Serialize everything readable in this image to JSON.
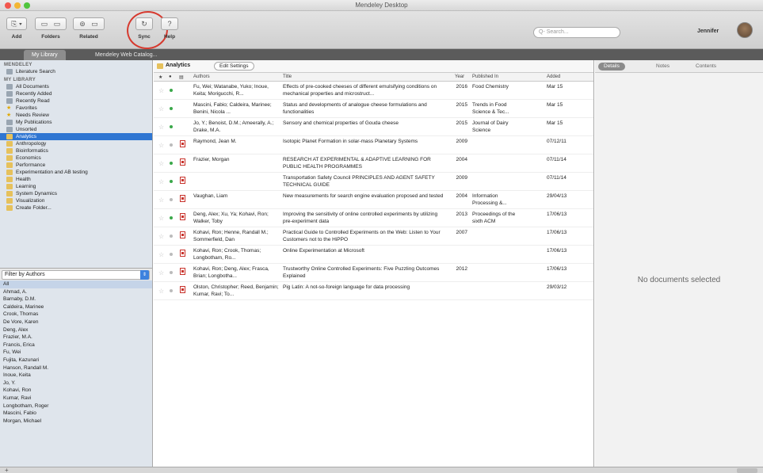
{
  "window": {
    "title": "Mendeley Desktop"
  },
  "toolbar": {
    "buttons": [
      {
        "label": "Add"
      },
      {
        "label": "Folders"
      },
      {
        "label": "Related"
      },
      {
        "label": "Sync"
      },
      {
        "label": "Help"
      }
    ],
    "search_placeholder": "Q- Search...",
    "user_name": "Jennifer"
  },
  "tabs": [
    {
      "label": "My Library",
      "active": true
    },
    {
      "label": "Mendeley Web Catalog...",
      "active": false
    }
  ],
  "sidebar": {
    "mendeley_header": "MENDELEY",
    "mendeley_items": [
      "Literature Search"
    ],
    "library_header": "MY LIBRARY",
    "library_items": [
      {
        "label": "All Documents",
        "icon": "grey"
      },
      {
        "label": "Recently Added",
        "icon": "grey"
      },
      {
        "label": "Recently Read",
        "icon": "grey"
      },
      {
        "label": "Favorites",
        "icon": "star"
      },
      {
        "label": "Needs Review",
        "icon": "star"
      },
      {
        "label": "My Publications",
        "icon": "grey"
      },
      {
        "label": "Unsorted",
        "icon": "grey"
      }
    ],
    "folders": [
      {
        "label": "Analytics",
        "selected": true,
        "sub": false
      },
      {
        "label": "Anthropology",
        "selected": false,
        "sub": false
      },
      {
        "label": "Bioinformatics",
        "selected": false,
        "sub": false
      },
      {
        "label": "Economics",
        "selected": false,
        "sub": false
      },
      {
        "label": "Performance",
        "selected": false,
        "sub": false
      },
      {
        "label": "Experimentation and AB testing",
        "selected": false,
        "sub": false
      },
      {
        "label": "Health",
        "selected": false,
        "sub": false
      },
      {
        "label": "Learning",
        "selected": false,
        "sub": false
      },
      {
        "label": "System Dynamics",
        "selected": false,
        "sub": false
      },
      {
        "label": "Visualization",
        "selected": false,
        "sub": false
      },
      {
        "label": "Create Folder...",
        "selected": false,
        "sub": false
      }
    ]
  },
  "filter": {
    "label": "Filter by Authors",
    "authors": [
      "All",
      "Ahmad, A.",
      "Barnaby, D.M.",
      "Caldeira, Marinee",
      "Crook, Thomas",
      "De Vore, Karen",
      "Deng, Alex",
      "Frazier, M.A.",
      "Francis, Erica",
      "Fu, Wei",
      "Fujita, Kazunari",
      "Hanson, Randall M.",
      "Inoue, Keita",
      "Jo, Y.",
      "Kohavi, Ron",
      "Kumar, Ravi",
      "Longbotham, Roger",
      "Mascini, Fabio",
      "Morgan, Michael"
    ]
  },
  "doclist": {
    "folder_title": "Analytics",
    "edit_button": "Edit Settings",
    "columns": {
      "authors": "Authors",
      "title": "Title",
      "year": "Year",
      "published_in": "Published In",
      "added": "Added"
    },
    "rows": [
      {
        "authors": "Fu, Wei; Watanabe, Yuko; Inoue, Keita; Morigucchi, R...",
        "title": "Effects of pre-cooked cheeses of different emulsifying conditions on mechanical properties and microstruct...",
        "year": "2016",
        "publisher": "Food Chemistry",
        "added": "Mar 15",
        "dot": "green",
        "pdf": false
      },
      {
        "authors": "Mascini, Fabio; Caldeira, Marinee; Benini, Nicola ...",
        "title": "Status and developments of analogue cheese formulations and functionalities",
        "year": "2015",
        "publisher": "Trends in Food Science & Tec...",
        "added": "Mar 15",
        "dot": "green",
        "pdf": false
      },
      {
        "authors": "Jo, Y.; Benoist, D.M.; Ameerally, A.; Drake, M.A.",
        "title": "Sensory and chemical properties of Gouda cheese",
        "year": "2015",
        "publisher": "Journal of Dairy Science",
        "added": "Mar 15",
        "dot": "green",
        "pdf": false
      },
      {
        "authors": "Raymond, Jean M.",
        "title": "Isotopic Planet Formation in solar-mass Planetary Systems",
        "year": "2009",
        "publisher": "",
        "added": "07/12/11",
        "dot": "grey",
        "pdf": true
      },
      {
        "authors": "Frazier, Morgan",
        "title": "RESEARCH AT EXPERIMENTAL & ADAPTIVE LEARNING FOR PUBLIC HEALTH PROGRAMMES",
        "year": "2004",
        "publisher": "",
        "added": "07/11/14",
        "dot": "green",
        "pdf": true
      },
      {
        "authors": "",
        "title": "Transportation Safety Council PRINCIPLES AND AGENT SAFETY TECHNICAL GUIDE",
        "year": "2009",
        "publisher": "",
        "added": "07/11/14",
        "dot": "green",
        "pdf": true
      },
      {
        "authors": "Vaughan, Liam",
        "title": "New measurements for search engine evaluation proposed and tested",
        "year": "2004",
        "publisher": "Information Processing &...",
        "added": "29/04/13",
        "dot": "grey",
        "pdf": true
      },
      {
        "authors": "Deng, Alex; Xu, Ya; Kohavi, Ron; Walker, Toby",
        "title": "Improving the sensitivity of online controlled experiments by utilizing pre-experiment data",
        "year": "2013",
        "publisher": "Proceedings of the sixth ACM",
        "added": "17/06/13",
        "dot": "green",
        "pdf": true
      },
      {
        "authors": "Kohavi, Ron; Henne, Randall M.; Sommerfield, Dan",
        "title": "Practical Guide to Controlled Experiments on the Web: Listen to Your Customers not to the HiPPO",
        "year": "2007",
        "publisher": "",
        "added": "17/06/13",
        "dot": "grey",
        "pdf": true
      },
      {
        "authors": "Kohavi, Ron; Crook, Thomas; Longbotham, Ro...",
        "title": "Online Experimentation at Microsoft",
        "year": "",
        "publisher": "",
        "added": "17/06/13",
        "dot": "grey",
        "pdf": true
      },
      {
        "authors": "Kohavi, Ron; Deng, Alex; Frasca, Brian; Longbotha...",
        "title": "Trustworthy Online Controlled Experiments: Five Puzzling Outcomes Explained",
        "year": "2012",
        "publisher": "",
        "added": "17/06/13",
        "dot": "grey",
        "pdf": true
      },
      {
        "authors": "Olston, Christopher; Reed, Benjamin; Kumar, Ravi; To...",
        "title": "Pig Latin: A not-so-foreign language for data processing",
        "year": "",
        "publisher": "",
        "added": "29/03/12",
        "dot": "grey",
        "pdf": true
      }
    ]
  },
  "detail": {
    "tabs": [
      "Details",
      "Notes",
      "Contents"
    ],
    "empty_message": "No documents selected"
  }
}
